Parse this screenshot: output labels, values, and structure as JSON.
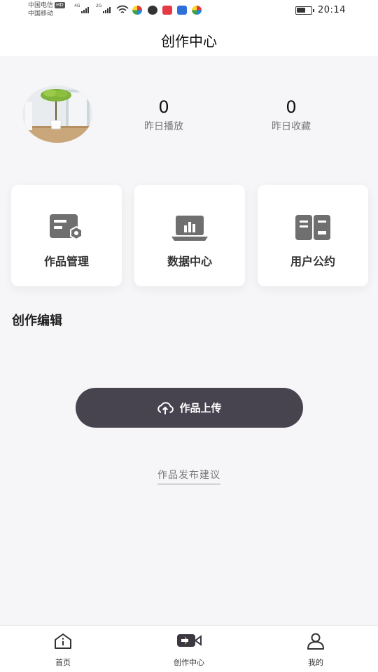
{
  "status_bar": {
    "carrier_1": "中国电信",
    "carrier_1_badge": "HD",
    "carrier_2": "中国移动",
    "network_1": "4G",
    "network_2": "2G",
    "time": "20:14"
  },
  "header": {
    "title": "创作中心"
  },
  "profile": {
    "avatar_icon": "plant-photo-avatar",
    "stats": [
      {
        "value": "0",
        "label": "昨日播放"
      },
      {
        "value": "0",
        "label": "昨日收藏"
      }
    ]
  },
  "cards": [
    {
      "label": "作品管理",
      "icon": "document-settings-icon"
    },
    {
      "label": "数据中心",
      "icon": "laptop-chart-icon"
    },
    {
      "label": "用户公约",
      "icon": "open-book-icon"
    }
  ],
  "section": {
    "title": "创作编辑"
  },
  "upload": {
    "label": "作品上传",
    "icon": "cloud-upload-icon"
  },
  "advice_link": "作品发布建议",
  "tabbar": {
    "items": [
      {
        "label": "首页",
        "icon": "home-icon"
      },
      {
        "label": "创作中心",
        "icon": "video-camera-icon"
      },
      {
        "label": "我的",
        "icon": "user-icon"
      }
    ]
  },
  "colors": {
    "background": "#f6f6f8",
    "card": "#ffffff",
    "button": "#47444f",
    "icon_gray": "#6f6f6f"
  }
}
